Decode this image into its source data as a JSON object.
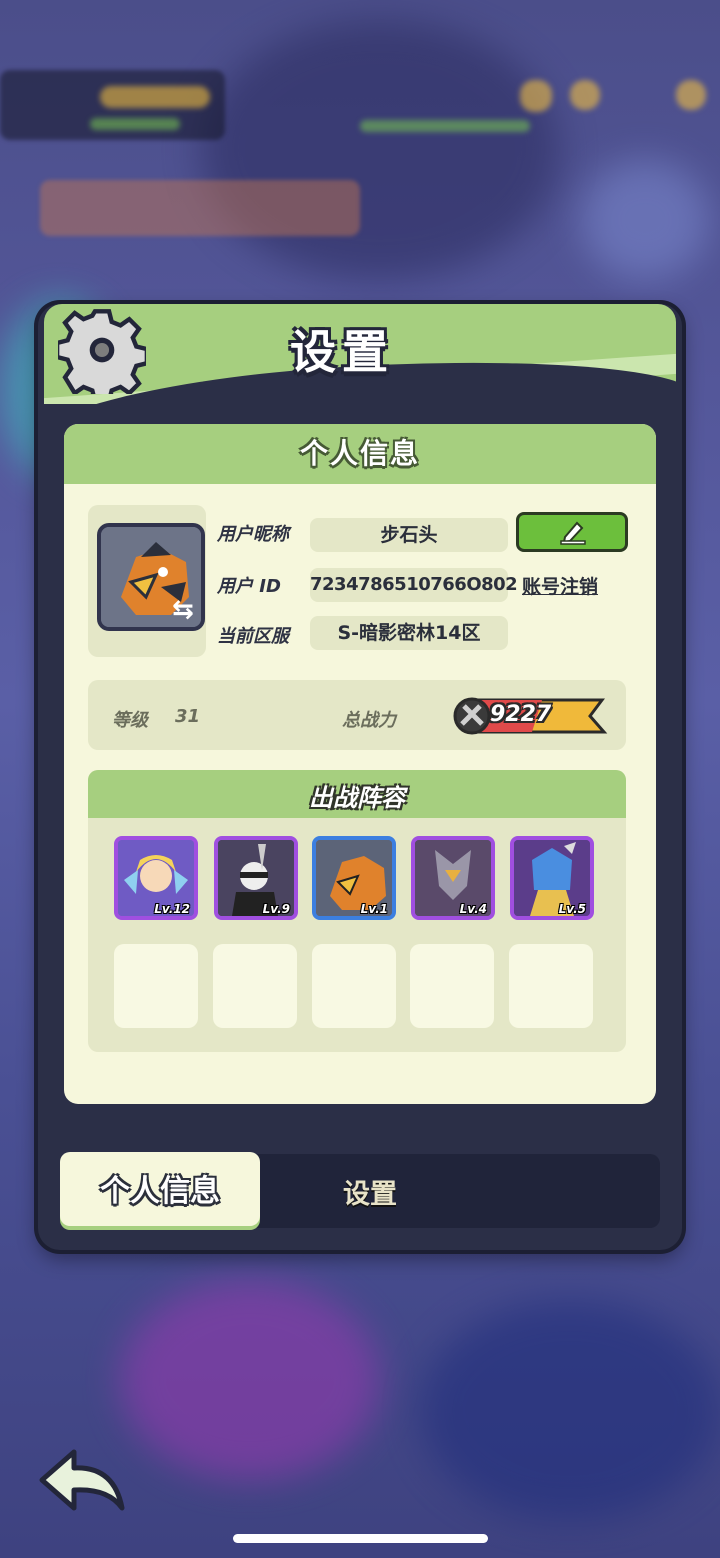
{
  "header": {
    "title": "设置"
  },
  "personal_info": {
    "section_title": "个人信息",
    "nickname_label": "用户昵称",
    "nickname_value": "步石头",
    "user_id_label": "用户 ID",
    "user_id_value": "7234786510766O802",
    "server_label": "当前区服",
    "server_value": "S-暗影密林14区",
    "account_cancel_link": "账号注销",
    "level_label": "等级",
    "level_value": "31",
    "power_label": "总战力",
    "power_value": "9227"
  },
  "lineup": {
    "title": "出战阵容",
    "heroes": [
      {
        "level": "Lv.12"
      },
      {
        "level": "Lv.9"
      },
      {
        "level": "Lv.1"
      },
      {
        "level": "Lv.4"
      },
      {
        "level": "Lv.5"
      }
    ]
  },
  "tabs": {
    "active": "个人信息",
    "other": "设置"
  },
  "icons": {
    "gear": "gear-icon",
    "edit": "pencil-icon",
    "back": "back-arrow-icon",
    "swap": "swap-icon",
    "sword": "crossed-swords-icon"
  },
  "colors": {
    "panel": "#2b2f47",
    "accent_green": "#a6cf7f",
    "cream": "#f6f7dc",
    "edit_button": "#6cbf3c"
  }
}
